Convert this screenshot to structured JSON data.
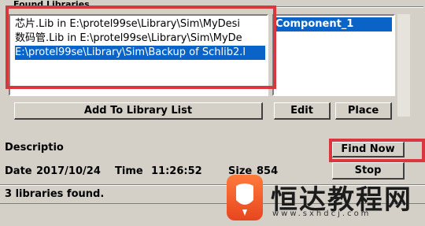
{
  "group": {
    "title": "Found Libraries"
  },
  "libraries": [
    {
      "text": "芯片.Lib in E:\\protel99se\\Library\\Sim\\MyDesi",
      "selected": false
    },
    {
      "text": "数码管.Lib in E:\\protel99se\\Library\\Sim\\MyDe",
      "selected": false
    },
    {
      "text": "E:\\protel99se\\Library\\Sim\\Backup of Schlib2.l",
      "selected": true
    }
  ],
  "components": [
    {
      "text": "Component_1",
      "selected": true
    }
  ],
  "buttons": {
    "add_to_library_list": "Add To Library List",
    "edit": "Edit",
    "place": "Place",
    "find_now": "Find Now",
    "stop": "Stop"
  },
  "details": {
    "description_label": "Descriptio",
    "date_label": "Date",
    "date_value": "2017/10/24",
    "time_label": "Time",
    "time_value": "11:26:52",
    "size_label": "Size",
    "size_value": "854"
  },
  "status": {
    "text": "3 libraries found."
  },
  "watermark": {
    "brand": "恒达教程网",
    "url": "www.sxhdcj.com"
  },
  "colors": {
    "selection": "#0a64c8",
    "highlight_box": "#d9363e",
    "window_bg": "#d4d0c8"
  }
}
